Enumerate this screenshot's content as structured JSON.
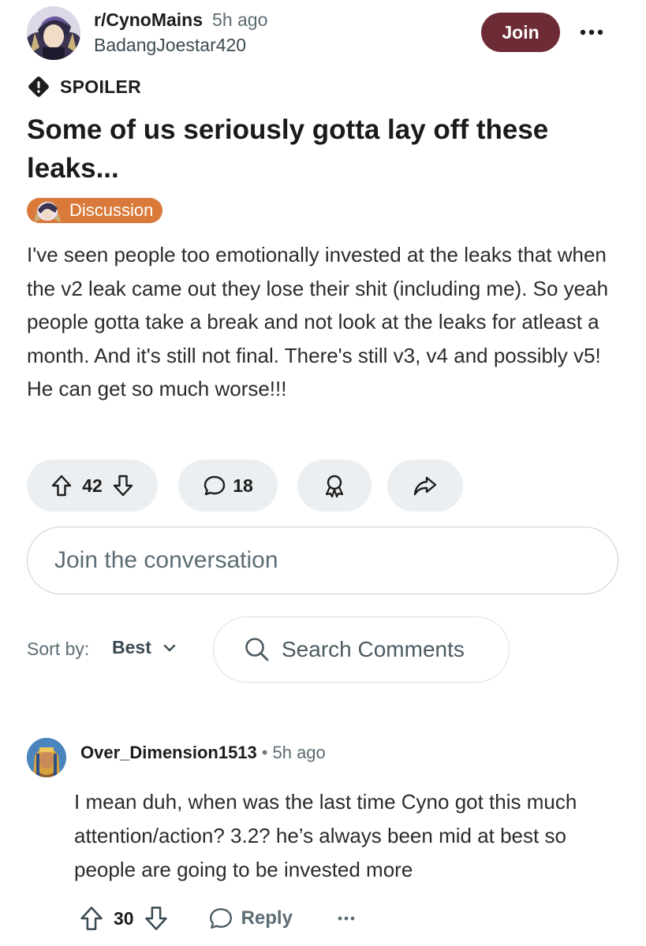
{
  "post": {
    "subreddit": "r/CynoMains",
    "time": "5h ago",
    "author": "BadangJoestar420",
    "join_label": "Join",
    "spoiler_label": "SPOILER",
    "title": "Some of us seriously gotta lay off these leaks...",
    "flair": "Discussion",
    "body": "I've seen people too emotionally invested at the leaks that when the v2 leak came out they lose their shit (including me). So yeah people gotta take a break and not look at the leaks for atleast a month. And it's still not final. There's still v3, v4 and possibly v5! He can get so much worse!!!",
    "upvotes": "42",
    "comments": "18"
  },
  "conversation": {
    "placeholder": "Join the conversation"
  },
  "sort": {
    "label": "Sort by:",
    "value": "Best",
    "search_label": "Search Comments"
  },
  "comment": {
    "user": "Over_Dimension1513",
    "dot": "•",
    "time": "5h ago",
    "text": "I mean duh, when was the last time Cyno got this much attention/action? 3.2? he’s always been mid at best so people are going to be invested more",
    "upvotes": "30",
    "reply_label": "Reply"
  },
  "colors": {
    "join_button": "#6d2b36",
    "flair_bg": "#d97a3a",
    "pill_bg": "#eceff1"
  }
}
